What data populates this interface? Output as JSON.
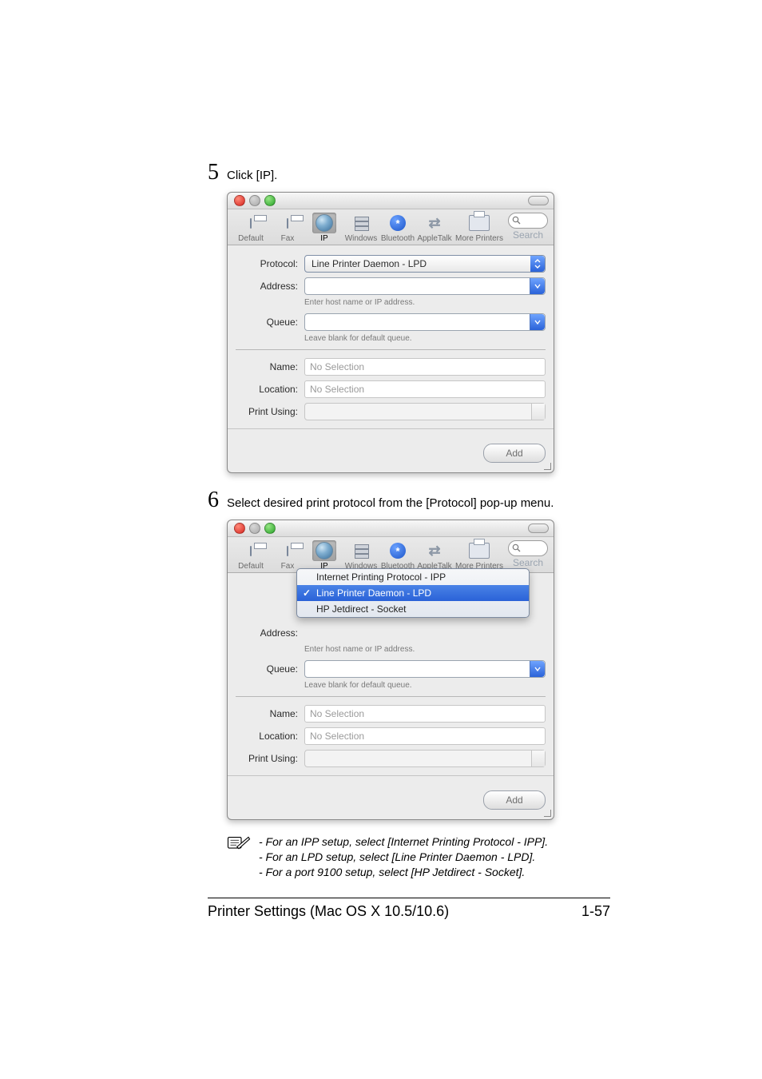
{
  "steps": {
    "s5": {
      "num": "5",
      "text": "Click [IP]."
    },
    "s6": {
      "num": "6",
      "text": "Select desired print protocol from the [Protocol] pop-up menu."
    }
  },
  "toolbar": {
    "default": "Default",
    "fax": "Fax",
    "ip": "IP",
    "windows": "Windows",
    "bluetooth": "Bluetooth",
    "appletalk": "AppleTalk",
    "more": "More Printers",
    "search": "Search"
  },
  "form": {
    "protocol_label": "Protocol:",
    "protocol_value": "Line Printer Daemon - LPD",
    "address_label": "Address:",
    "address_hint": "Enter host name or IP address.",
    "queue_label": "Queue:",
    "queue_hint": "Leave blank for default queue.",
    "name_label": "Name:",
    "name_value": "No Selection",
    "location_label": "Location:",
    "location_value": "No Selection",
    "printusing_label": "Print Using:",
    "add_button": "Add"
  },
  "popup": {
    "ipp": "Internet Printing Protocol - IPP",
    "lpd": "Line Printer Daemon - LPD",
    "socket": "HP Jetdirect - Socket",
    "check": "✓"
  },
  "notes": {
    "n1": "- For an IPP setup, select [Internet Printing Protocol - IPP].",
    "n2": "- For an LPD setup, select [Line Printer Daemon - LPD].",
    "n3": "- For a port 9100 setup, select [HP Jetdirect - Socket]."
  },
  "footer": {
    "title": "Printer Settings (Mac OS X 10.5/10.6)",
    "page": "1-57"
  },
  "glyphs": {
    "bt": "*"
  }
}
